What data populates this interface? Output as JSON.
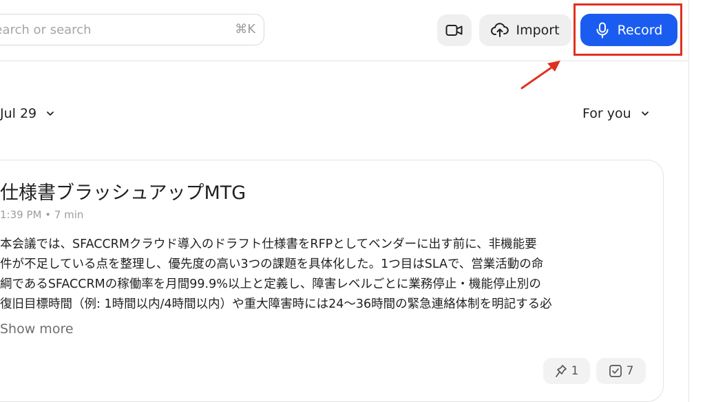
{
  "header": {
    "search": {
      "placeholder": "Search or search",
      "shortcut": "⌘K"
    },
    "video_icon": "video-camera-icon",
    "import": {
      "label": "Import",
      "icon": "cloud-upload-icon"
    },
    "record": {
      "label": "Record",
      "icon": "microphone-icon",
      "color": "#1a5cf0"
    },
    "highlight_color": "#e0301e"
  },
  "filters": {
    "date": "Jul 29",
    "feed": "For you"
  },
  "meeting_card": {
    "title": "仕様書ブラッシュアップMTG",
    "meta": "1:39 PM • 7 min",
    "summary_lines": [
      "本会議では、SFACCRMクラウド導入のドラフト仕様書をRFPとしてベンダーに出す前に、非機能要",
      "件が不足している点を整理し、優先度の高い3つの課題を具体化した。1つ目はSLAで、営業活動の命",
      "綱であるSFACCRMの稼働率を月間99.9%以上と定義し、障害レベルごとに業務停止・機能停止別の",
      "復旧目標時間（例: 1時間以内/4時間以内）や重大障害時には24〜36時間の緊急連絡体制を明記する必"
    ],
    "show_more": "Show more",
    "badges": [
      {
        "icon": "pin-icon",
        "count": "1"
      },
      {
        "icon": "checkbox-icon",
        "count": "7"
      }
    ]
  }
}
